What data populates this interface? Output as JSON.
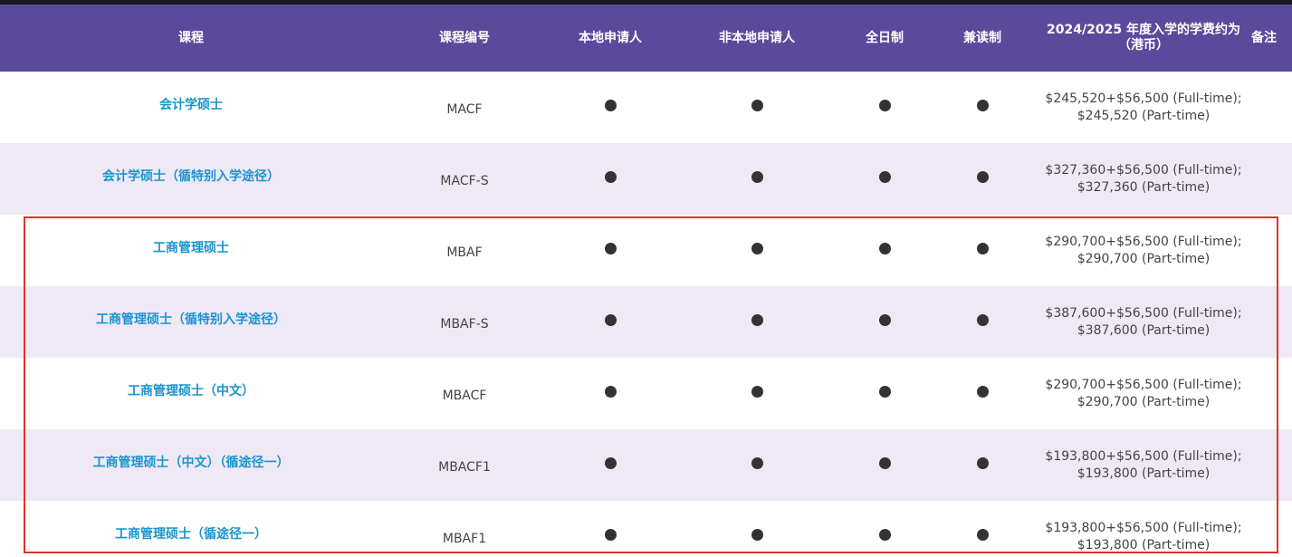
{
  "table": {
    "headers": {
      "course": "课程",
      "code": "课程编号",
      "local": "本地申请人",
      "nonlocal": "非本地申请人",
      "fulltime": "全日制",
      "parttime": "兼读制",
      "fee": "2024/2025 年度入学的学费约为（港币）",
      "note": "备注"
    },
    "rows": [
      {
        "name": "会计学硕士",
        "code": "MACF",
        "fee": "$245,520+$56,500 (Full-time); $245,520 (Part-time)"
      },
      {
        "name": "会计学硕士（循特别入学途径）",
        "code": "MACF-S",
        "fee": "$327,360+$56,500 (Full-time); $327,360 (Part-time)"
      },
      {
        "name": "工商管理硕士",
        "code": "MBAF",
        "fee": "$290,700+$56,500 (Full-time); $290,700 (Part-time)"
      },
      {
        "name": "工商管理硕士（循特别入学途径）",
        "code": "MBAF-S",
        "fee": "$387,600+$56,500 (Full-time); $387,600 (Part-time)"
      },
      {
        "name": "工商管理硕士（中文）",
        "code": "MBACF",
        "fee": "$290,700+$56,500 (Full-time); $290,700 (Part-time)"
      },
      {
        "name": "工商管理硕士（中文）（循途径一）",
        "code": "MBACF1",
        "fee": "$193,800+$56,500 (Full-time); $193,800 (Part-time)"
      },
      {
        "name": "工商管理硕士（循途径一）",
        "code": "MBAF1",
        "fee": "$193,800+$56,500 (Full-time); $193,800 (Part-time)"
      }
    ]
  },
  "colors": {
    "header_bg": "#5b4a9c",
    "alt_row_bg": "#efe9f6",
    "link_blue": "#1a94cf",
    "highlight_red": "#e3302f"
  }
}
